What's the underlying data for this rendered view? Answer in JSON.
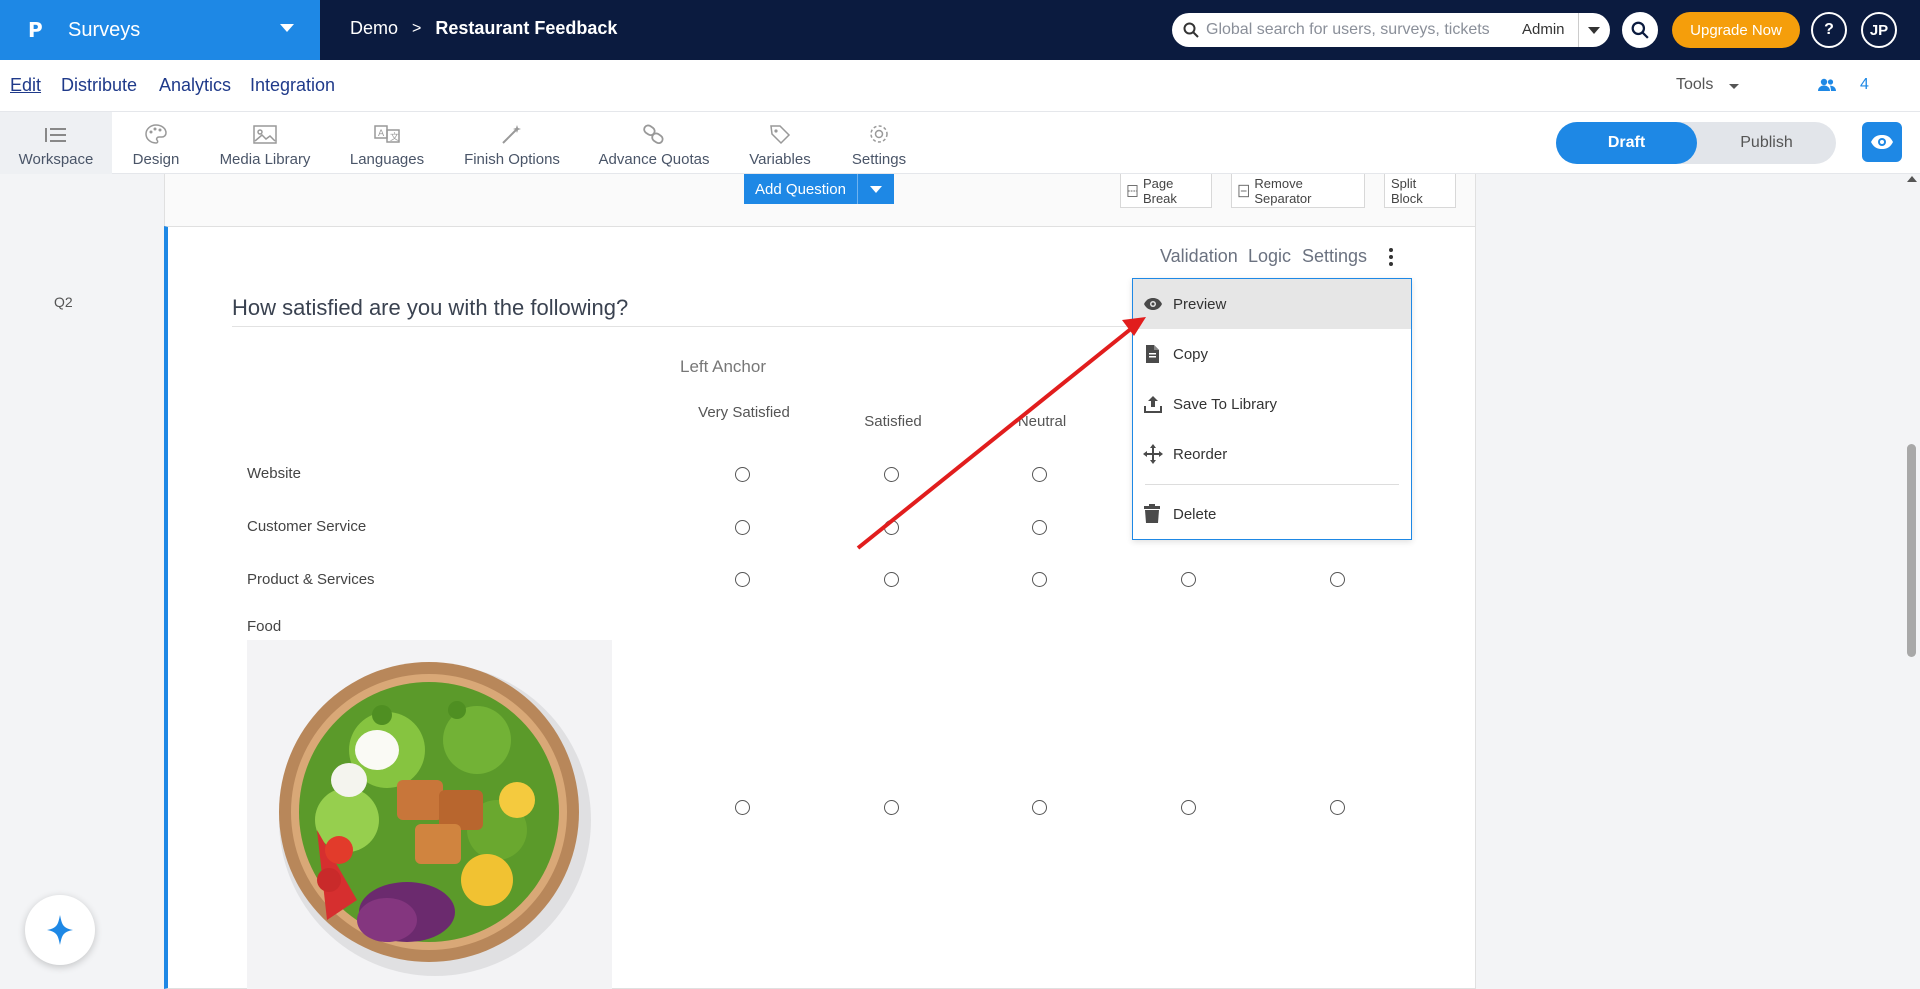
{
  "brand": {
    "logo": "P",
    "name": "Surveys"
  },
  "breadcrumb": {
    "parent": "Demo",
    "separator": ">",
    "current": "Restaurant Feedback"
  },
  "global_search": {
    "placeholder": "Global search for users, surveys, tickets",
    "role": "Admin"
  },
  "header": {
    "upgrade_label": "Upgrade Now",
    "help_label": "?",
    "avatar_initials": "JP"
  },
  "menu": {
    "items": [
      "Edit",
      "Distribute",
      "Analytics",
      "Integration"
    ],
    "tools_label": "Tools",
    "collaborators_count": "4"
  },
  "toolbar": {
    "items": [
      "Workspace",
      "Design",
      "Media Library",
      "Languages",
      "Finish Options",
      "Advance Quotas",
      "Variables",
      "Settings"
    ],
    "draft_label": "Draft",
    "publish_label": "Publish"
  },
  "block_actions": {
    "add_question": "Add Question",
    "page_break": "Page Break",
    "remove_separator": "Remove Separator",
    "split_block": "Split Block"
  },
  "question": {
    "number": "Q2",
    "title": "How satisfied are you with the following?",
    "tabs": [
      "Validation",
      "Logic",
      "Settings"
    ],
    "left_anchor": "Left Anchor",
    "columns": [
      "Very Satisfied",
      "Satisfied",
      "Neutral"
    ],
    "rows": [
      "Website",
      "Customer Service",
      "Product & Services",
      "Food"
    ]
  },
  "context_menu": {
    "items": [
      "Preview",
      "Copy",
      "Save To Library",
      "Reorder",
      "Delete"
    ],
    "highlighted": "Preview"
  },
  "colors": {
    "brand_blue": "#1e88e5",
    "navy": "#0b1b3f",
    "upgrade_orange": "#f59e0b",
    "annotation_red": "#e11d1d"
  }
}
